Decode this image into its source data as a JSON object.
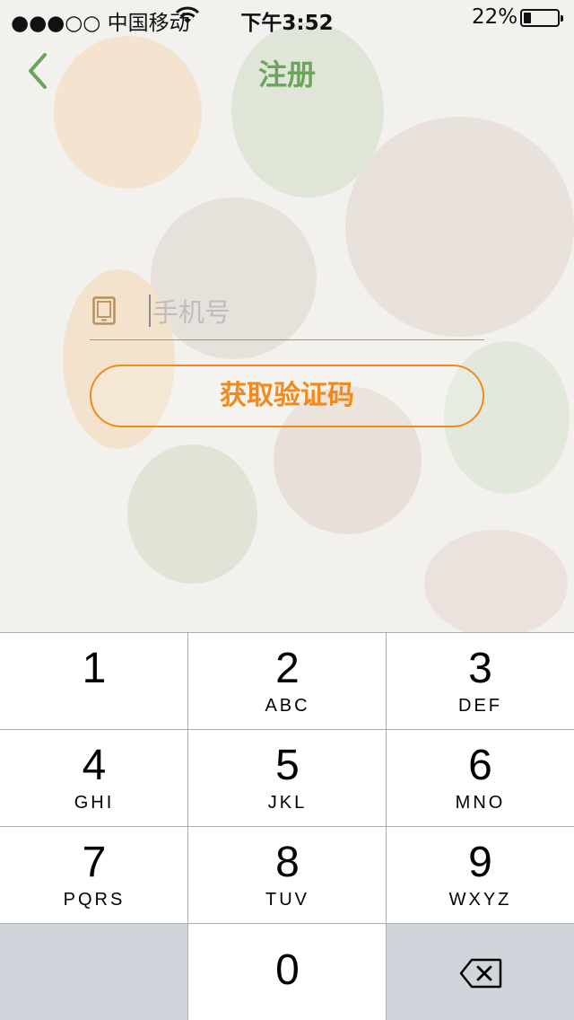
{
  "status_bar": {
    "carrier": "●●●○○ 中国移动",
    "time": "下午3:52",
    "battery": "22%",
    "battery_level": 0.22
  },
  "nav": {
    "title": "注册",
    "back_icon": "chevron-left-icon"
  },
  "form": {
    "phone_placeholder": "手机号",
    "phone_value": "",
    "phone_icon": "tablet-icon",
    "get_code_label": "获取验证码"
  },
  "colors": {
    "accent_green": "#6aa55a",
    "accent_orange": "#f08a1e"
  },
  "keypad": {
    "keys": [
      {
        "digit": "1",
        "letters": ""
      },
      {
        "digit": "2",
        "letters": "ABC"
      },
      {
        "digit": "3",
        "letters": "DEF"
      },
      {
        "digit": "4",
        "letters": "GHI"
      },
      {
        "digit": "5",
        "letters": "JKL"
      },
      {
        "digit": "6",
        "letters": "MNO"
      },
      {
        "digit": "7",
        "letters": "PQRS"
      },
      {
        "digit": "8",
        "letters": "TUV"
      },
      {
        "digit": "9",
        "letters": "WXYZ"
      },
      {
        "digit": "0",
        "letters": ""
      }
    ],
    "delete_icon": "backspace-icon"
  }
}
